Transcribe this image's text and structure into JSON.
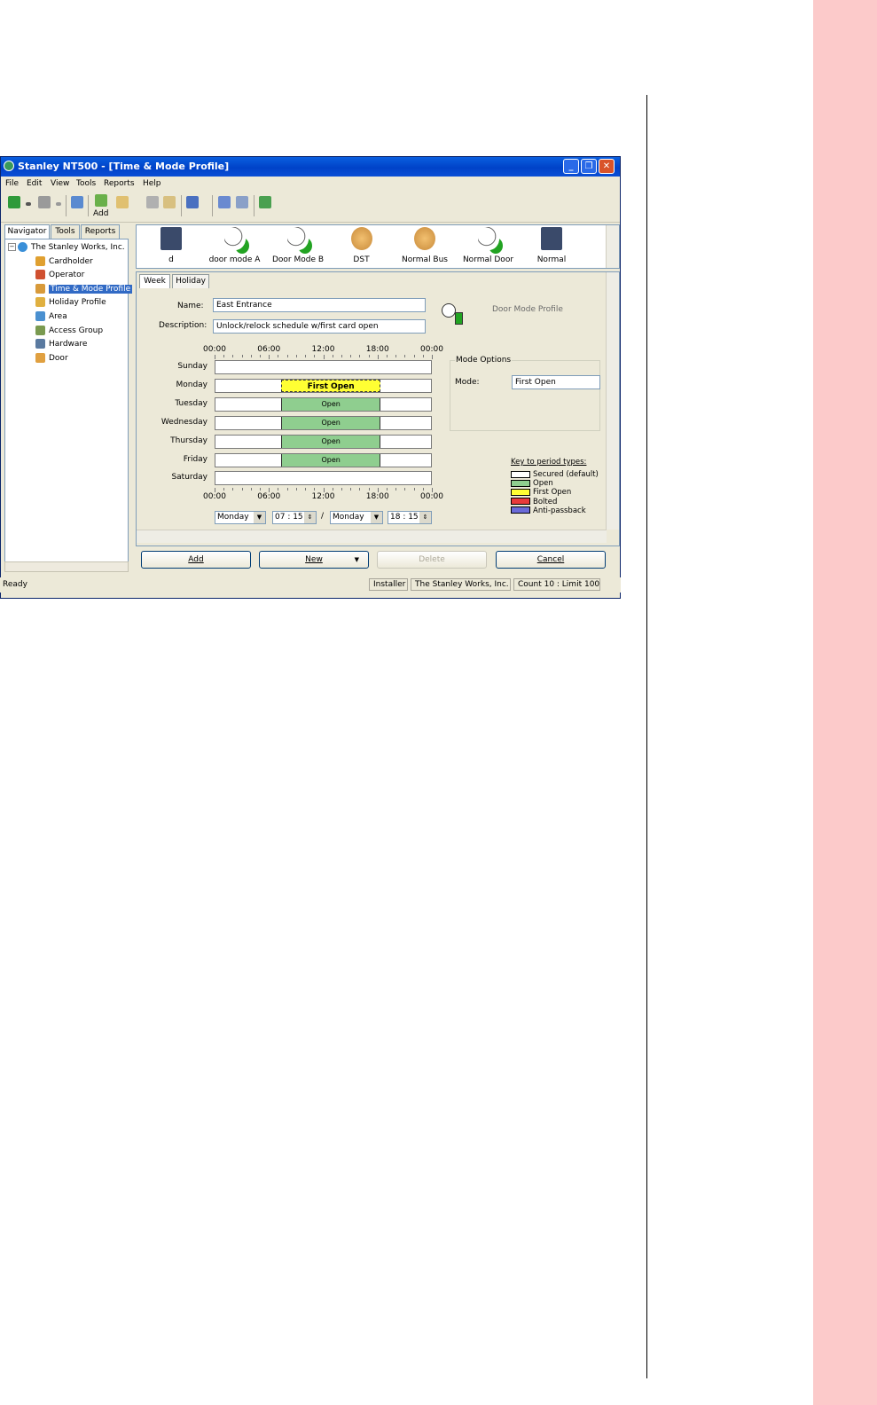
{
  "window": {
    "title": "Stanley NT500 - [Time & Mode Profile]",
    "controls": [
      "_",
      "❐",
      "✕"
    ]
  },
  "menu": [
    "File",
    "Edit",
    "View",
    "Tools",
    "Reports",
    "Help"
  ],
  "toolbar": {
    "add_label": "Add"
  },
  "navigator": {
    "tabs": [
      "Navigator",
      "Tools",
      "Reports"
    ],
    "tree": [
      {
        "label": "The Stanley Works, Inc.",
        "icon": "globe-icon",
        "color": "#3a8fd8"
      },
      {
        "label": "Cardholder",
        "icon": "cardholder-icon",
        "color": "#e0a030"
      },
      {
        "label": "Operator",
        "icon": "operator-icon",
        "color": "#d05030"
      },
      {
        "label": "Time & Mode Profile",
        "icon": "clock-profile-icon",
        "color": "#d89a3a",
        "selected": true
      },
      {
        "label": "Holiday Profile",
        "icon": "holiday-icon",
        "color": "#e0b040"
      },
      {
        "label": "Area",
        "icon": "area-icon",
        "color": "#4a90d0"
      },
      {
        "label": "Access Group",
        "icon": "access-group-icon",
        "color": "#7a9a50"
      },
      {
        "label": "Hardware",
        "icon": "hardware-icon",
        "color": "#5a7aa0"
      },
      {
        "label": "Door",
        "icon": "door-icon",
        "color": "#e0a040"
      }
    ]
  },
  "profiles": [
    {
      "label": "d",
      "icon": "time-profile-icon"
    },
    {
      "label": "door mode A",
      "icon": "door-mode-icon"
    },
    {
      "label": "Door Mode B",
      "icon": "door-mode-icon"
    },
    {
      "label": "DST",
      "icon": "dst-icon"
    },
    {
      "label": "Normal Bus",
      "icon": "dst-icon"
    },
    {
      "label": "Normal Door",
      "icon": "door-mode-icon"
    },
    {
      "label": "Normal",
      "icon": "time-profile-icon"
    }
  ],
  "tabs": [
    "Week",
    "Holiday"
  ],
  "form": {
    "name_label": "Name:",
    "name_value": "East Entrance",
    "description_label": "Description:",
    "description_value": "Unlock/relock schedule w/first card open",
    "profile_type": "Door Mode Profile"
  },
  "schedule": {
    "time_ticks": [
      "00:00",
      "06:00",
      "12:00",
      "18:00",
      "00:00"
    ],
    "days": [
      {
        "day": "Sunday",
        "periods": []
      },
      {
        "day": "Monday",
        "periods": [
          {
            "start": 7.25,
            "end": 18.25,
            "type": "first",
            "label": "First Open"
          }
        ]
      },
      {
        "day": "Tuesday",
        "periods": [
          {
            "start": 7.25,
            "end": 18.25,
            "type": "open",
            "label": "Open"
          }
        ]
      },
      {
        "day": "Wednesday",
        "periods": [
          {
            "start": 7.25,
            "end": 18.25,
            "type": "open",
            "label": "Open"
          }
        ]
      },
      {
        "day": "Thursday",
        "periods": [
          {
            "start": 7.25,
            "end": 18.25,
            "type": "open",
            "label": "Open"
          }
        ]
      },
      {
        "day": "Friday",
        "periods": [
          {
            "start": 7.25,
            "end": 18.25,
            "type": "open",
            "label": "Open"
          }
        ]
      },
      {
        "day": "Saturday",
        "periods": []
      }
    ],
    "start_day": "Monday",
    "start_time": "07 : 15",
    "separator": "/",
    "end_day": "Monday",
    "end_time": "18 : 15"
  },
  "mode_options": {
    "legend": "Mode Options",
    "mode_label": "Mode:",
    "mode_value": "First Open"
  },
  "key": {
    "title": "Key to period types:",
    "items": [
      {
        "label": "Secured (default)",
        "color": "#ffffff"
      },
      {
        "label": "Open",
        "color": "#8fce8f"
      },
      {
        "label": "First Open",
        "color": "#ffff33"
      },
      {
        "label": "Bolted",
        "color": "#e83a3a"
      },
      {
        "label": "Anti-passback",
        "color": "#6a6ad8"
      }
    ]
  },
  "buttons": {
    "add": "Add",
    "new": "New",
    "delete": "Delete",
    "cancel": "Cancel"
  },
  "status": {
    "left": "Ready",
    "user": "Installer",
    "company": "The Stanley Works, Inc.",
    "count": "Count 10 : Limit 100"
  }
}
